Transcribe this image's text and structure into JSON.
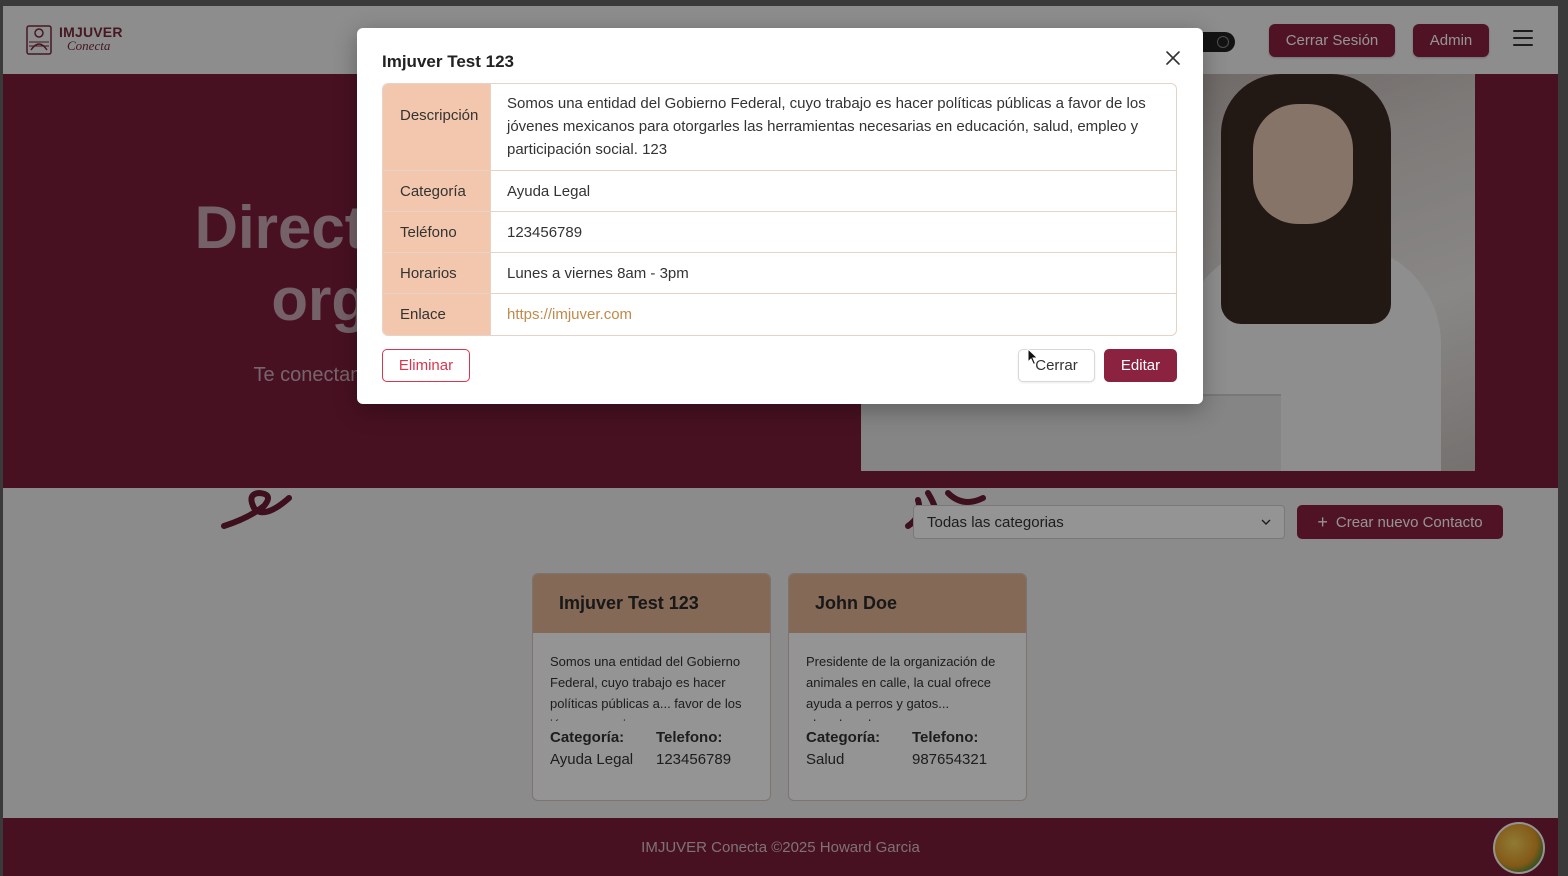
{
  "header": {
    "logo_title": "IMJUVER",
    "logo_subtitle": "Conecta",
    "logout_label": "Cerrar Sesión",
    "admin_label": "Admin"
  },
  "hero": {
    "title_line1": "Directorio d",
    "title_line2": "organi",
    "subtitle": "Te conectamos con los s"
  },
  "filter": {
    "category_select": "Todas las categorias",
    "create_label": "Crear nuevo Contacto"
  },
  "cards": [
    {
      "title": "Imjuver Test 123",
      "description": "Somos una entidad del Gobierno Federal, cuyo trabajo es hacer políticas públicas a... favor de los jóvenes mexicanos",
      "category_label": "Categoría:",
      "category": "Ayuda Legal",
      "phone_label": "Telefono:",
      "phone": "123456789"
    },
    {
      "title": "John Doe",
      "description": "Presidente de la organización de animales en calle, la cual ofrece ayuda a perros y gatos... abandonados.",
      "category_label": "Categoría:",
      "category": "Salud",
      "phone_label": "Telefono:",
      "phone": "987654321"
    }
  ],
  "footer": {
    "text": "IMJUVER Conecta ©2025 Howard Garcia"
  },
  "modal": {
    "title": "Imjuver Test 123",
    "rows": [
      {
        "label": "Descripción",
        "value": "Somos una entidad del Gobierno Federal, cuyo trabajo es hacer políticas públicas a favor de los jóvenes mexicanos para otorgarles las herramientas necesarias en educación, salud, empleo y participación social. 123"
      },
      {
        "label": "Categoría",
        "value": "Ayuda Legal"
      },
      {
        "label": "Teléfono",
        "value": "123456789"
      },
      {
        "label": "Horarios",
        "value": "Lunes a viernes 8am - 3pm"
      },
      {
        "label": "Enlace",
        "value": "https://imjuver.com"
      }
    ],
    "delete_label": "Eliminar",
    "close_label": "Cerrar",
    "edit_label": "Editar"
  },
  "colors": {
    "brand": "#8a2240",
    "hero_bg": "#7d1e3c",
    "card_header": "#e3b697",
    "table_label_bg": "#f2c7ad",
    "link": "#c08a4a",
    "danger": "#d9364e"
  },
  "icons": [
    "logo-icon",
    "menu-icon",
    "chevron-down-icon",
    "plus-icon",
    "close-icon",
    "avatar-icon",
    "cursor-icon"
  ]
}
